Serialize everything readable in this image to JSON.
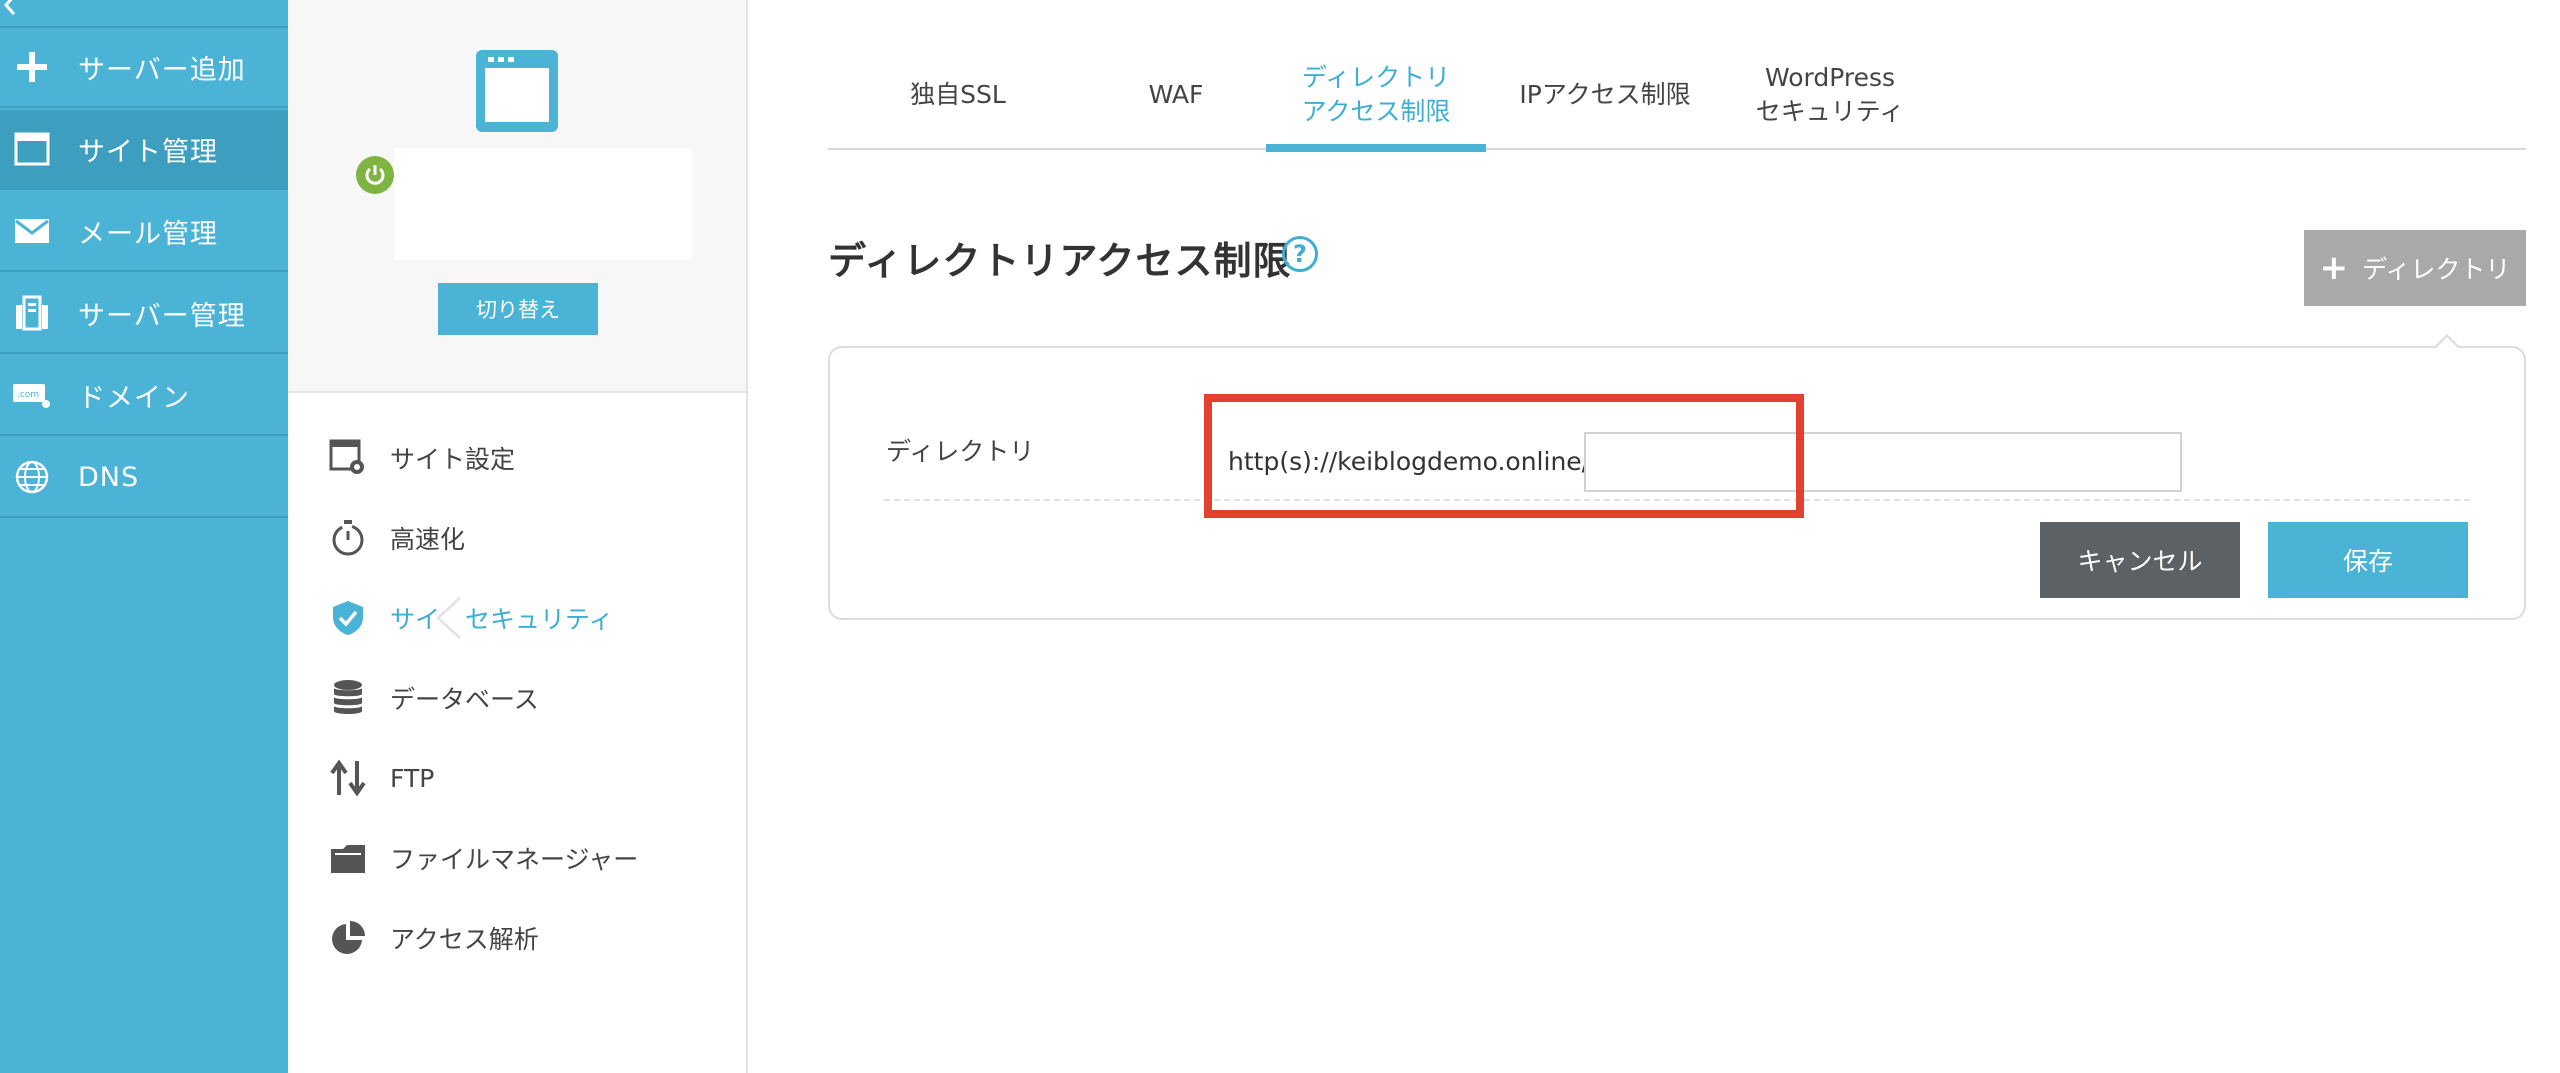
{
  "nav": {
    "collapse_icon": "chevron-left-icon",
    "items": [
      {
        "label": "サーバー追加",
        "icon": "plus-icon"
      },
      {
        "label": "サイト管理",
        "icon": "window-icon",
        "active": true
      },
      {
        "label": "メール管理",
        "icon": "mail-icon"
      },
      {
        "label": "サーバー管理",
        "icon": "server-icon"
      },
      {
        "label": "ドメイン",
        "icon": "dotcom-icon"
      },
      {
        "label": "DNS",
        "icon": "globe-icon"
      }
    ]
  },
  "site": {
    "status_icon": "power-icon",
    "status_color": "#7fb342",
    "switch_label": "切り替え",
    "menu": [
      {
        "label": "サイト設定",
        "icon": "site-settings-icon"
      },
      {
        "label": "高速化",
        "icon": "stopwatch-icon"
      },
      {
        "label": "サイトセキュリティ",
        "icon": "shield-check-icon",
        "active": true
      },
      {
        "label": "データベース",
        "icon": "database-icon"
      },
      {
        "label": "FTP",
        "icon": "transfer-arrows-icon"
      },
      {
        "label": "ファイルマネージャー",
        "icon": "folder-icon"
      },
      {
        "label": "アクセス解析",
        "icon": "pie-chart-icon"
      }
    ]
  },
  "tabs": [
    {
      "line1": "独自SSL",
      "line2": ""
    },
    {
      "line1": "WAF",
      "line2": ""
    },
    {
      "line1": "ディレクトリ",
      "line2": "アクセス制限",
      "active": true
    },
    {
      "line1": "IPアクセス制限",
      "line2": ""
    },
    {
      "line1": "WordPress",
      "line2": "セキュリティ"
    }
  ],
  "main": {
    "title": "ディレクトリアクセス制限",
    "help_icon": "question-circle-icon",
    "add_button_label": "ディレクトリ",
    "form": {
      "directory_label": "ディレクトリ",
      "url_prefix": "http(s)://keiblogdemo.online/",
      "directory_value": "",
      "cancel_label": "キャンセル",
      "save_label": "保存"
    }
  },
  "colors": {
    "accent": "#4ab3d6",
    "highlight": "#e2412f",
    "cancel": "#5b6164",
    "add_button": "#a9a9a9"
  }
}
